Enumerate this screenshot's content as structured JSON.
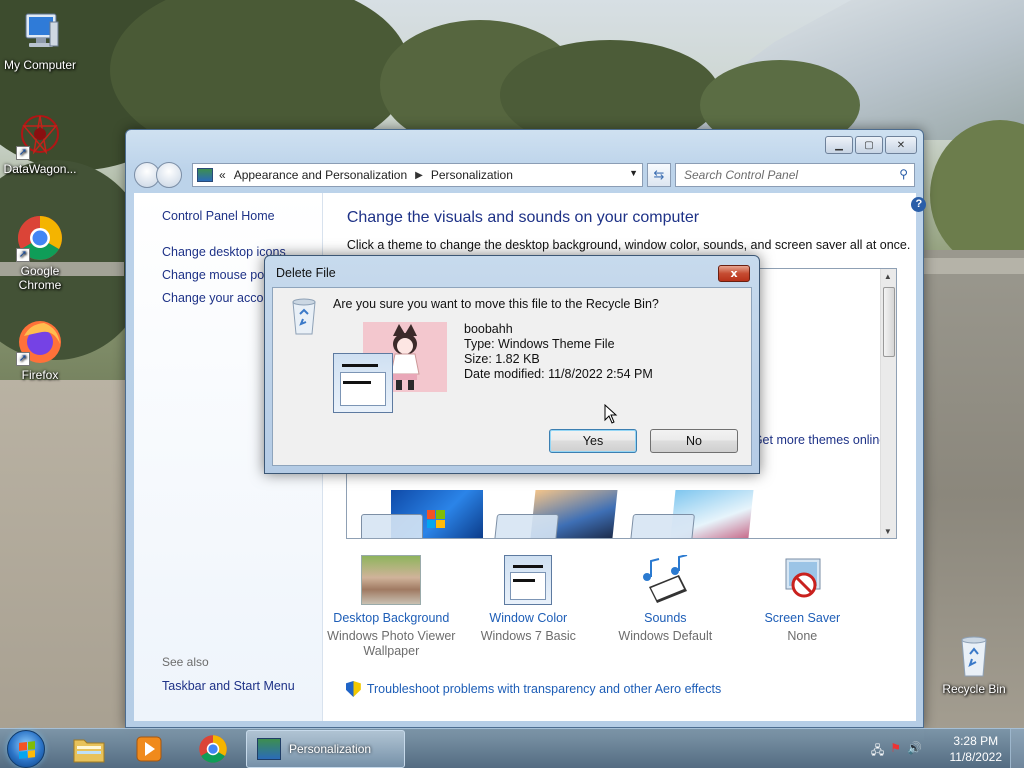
{
  "desktop": {
    "icons": [
      {
        "label": "My Computer"
      },
      {
        "label": "DataWagon..."
      },
      {
        "label": "Google Chrome"
      },
      {
        "label": "Firefox"
      },
      {
        "label": "Recycle Bin"
      }
    ]
  },
  "window": {
    "breadcrumb": [
      "Appearance and Personalization",
      "Personalization"
    ],
    "breadcrumb_prefix": "«",
    "search_placeholder": "Search Control Panel",
    "sidebar": {
      "home": "Control Panel Home",
      "links": [
        "Change desktop icons",
        "Change mouse pointers",
        "Change your account picture"
      ],
      "see_also": "See also",
      "see_also_link": "Taskbar and Start Menu"
    },
    "heading": "Change the visuals and sounds on your computer",
    "description": "Click a theme to change the desktop background, window color, sounds, and screen saver all at once.",
    "themes_online_link": "Get more themes online",
    "bottom_items": [
      {
        "title": "Desktop Background",
        "subtitle": "Windows Photo Viewer Wallpaper"
      },
      {
        "title": "Window Color",
        "subtitle": "Windows 7 Basic"
      },
      {
        "title": "Sounds",
        "subtitle": "Windows Default"
      },
      {
        "title": "Screen Saver",
        "subtitle": "None"
      }
    ],
    "troubleshoot_link": "Troubleshoot problems with transparency and other Aero effects"
  },
  "dialog": {
    "title": "Delete File",
    "close_label": "x",
    "question": "Are you sure you want to move this file to the Recycle Bin?",
    "file_name": "boobahh",
    "file_type": "Type: Windows Theme File",
    "file_size": "Size: 1.82 KB",
    "file_date": "Date modified: 11/8/2022 2:54 PM",
    "yes_label": "Yes",
    "no_label": "No"
  },
  "taskbar": {
    "active_task": "Personalization",
    "time": "3:28 PM",
    "date": "11/8/2022"
  },
  "colors": {
    "link": "#1e5eb7",
    "heading": "#1e3287",
    "dialog_frame": "#b4cbe5"
  }
}
